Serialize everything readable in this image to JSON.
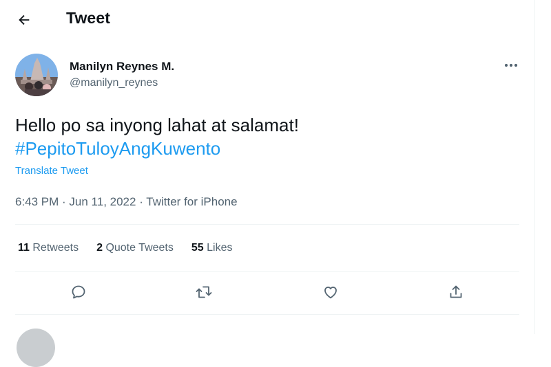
{
  "header": {
    "title": "Tweet"
  },
  "tweet": {
    "author_name": "Manilyn Reynes M.",
    "author_handle": "@manilyn_reynes",
    "text": "Hello po sa inyong lahat at salamat!",
    "hashtag": "#PepitoTuloyAngKuwento",
    "translate_label": "Translate Tweet",
    "time": "6:43 PM",
    "date": "Jun 11, 2022",
    "source": "Twitter for iPhone",
    "separator": " · "
  },
  "stats": {
    "retweets_count": "11",
    "retweets_label": "Retweets",
    "quotes_count": "2",
    "quotes_label": "Quote Tweets",
    "likes_count": "55",
    "likes_label": "Likes"
  },
  "icons": {
    "back": "arrow-left-icon",
    "more": "more-horizontal-icon",
    "reply": "reply-icon",
    "retweet": "retweet-icon",
    "like": "heart-icon",
    "share": "share-icon"
  },
  "colors": {
    "accent": "#1d9bf0",
    "text_primary": "#0f1419",
    "text_secondary": "#536471",
    "divider": "#eff3f4"
  }
}
